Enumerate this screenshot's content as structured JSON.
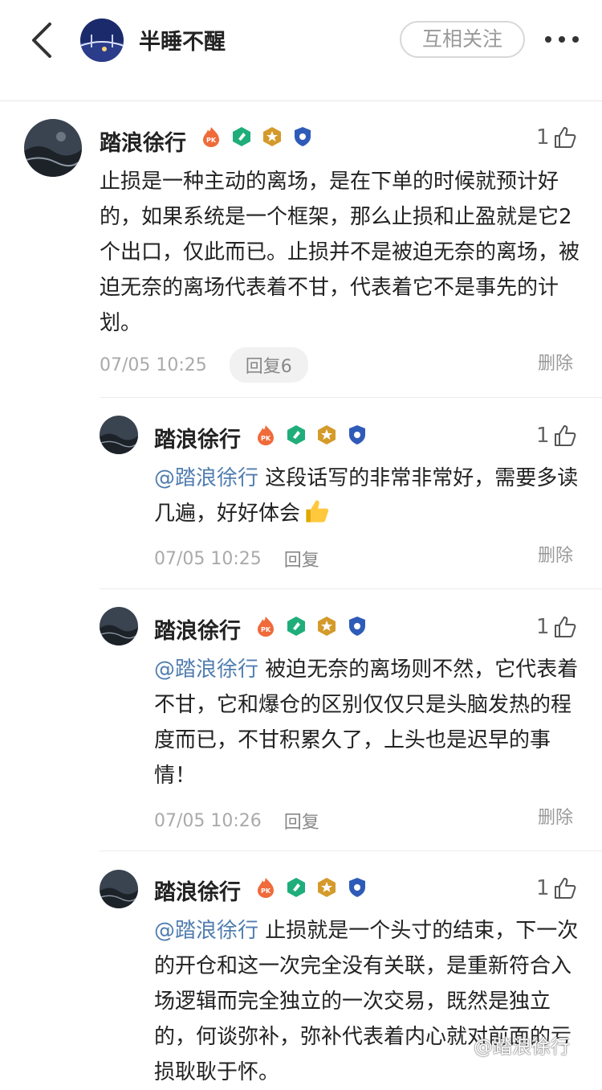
{
  "header": {
    "title": "半睡不醒",
    "follow_label": "互相关注"
  },
  "comments": [
    {
      "user": "踏浪徐行",
      "likes": "1",
      "text": "止损是一种主动的离场，是在下单的时候就预计好的，如果系统是一个框架，那么止损和止盈就是它2个出口，仅此而已。止损并不是被迫无奈的离场，被迫无奈的离场代表着不甘，代表着它不是事先的计划。",
      "time": "07/05 10:25",
      "reply_label": "回复6",
      "delete_label": "删除"
    },
    {
      "user": "踏浪徐行",
      "likes": "1",
      "mention": "@踏浪徐行",
      "text": " 这段话写的非常非常好，需要多读几遍，好好体会",
      "time": "07/05 10:25",
      "reply_label": "回复",
      "delete_label": "删除"
    },
    {
      "user": "踏浪徐行",
      "likes": "1",
      "mention": "@踏浪徐行",
      "text": " 被迫无奈的离场则不然，它代表着不甘，它和爆仓的区别仅仅只是头脑发热的程度而已，不甘积累久了，上头也是迟早的事情！",
      "time": "07/05 10:26",
      "reply_label": "回复",
      "delete_label": "删除"
    },
    {
      "user": "踏浪徐行",
      "likes": "1",
      "mention": "@踏浪徐行",
      "text": " 止损就是一个头寸的结束，下一次的开仓和这一次完全没有关联，是重新符合入场逻辑而完全独立的一次交易，既然是独立的，何谈弥补，弥补代表着内心就对前面的亏损耿耿于怀。"
    }
  ],
  "watermark": "@踏浪徐行",
  "icons": {
    "back": "chevron-left-icon",
    "more": "more-dots-icon",
    "like": "thumbs-up-icon",
    "badges": [
      "pk-fire-icon",
      "green-diamond-icon",
      "gold-star-icon",
      "blue-shield-icon"
    ],
    "emoji": "thumbs-up-emoji"
  },
  "colors": {
    "mention": "#507daf",
    "meta": "#aaaaaa"
  }
}
